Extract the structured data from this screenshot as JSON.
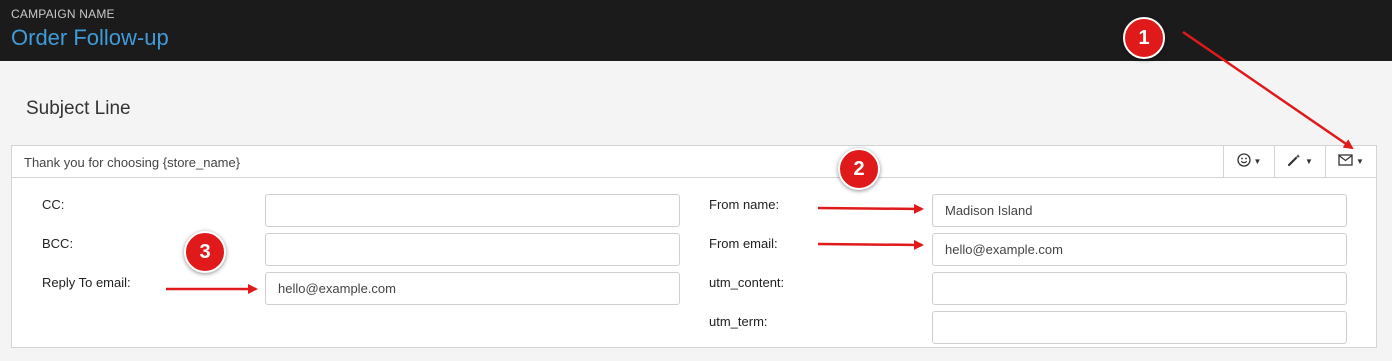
{
  "header": {
    "campaign_label": "CAMPAIGN NAME",
    "campaign_name": "Order Follow-up"
  },
  "subject": {
    "title": "Subject Line",
    "value": "Thank you for choosing {store_name}",
    "tools": [
      {
        "name": "emoji-dropdown",
        "icon": "smiley-icon"
      },
      {
        "name": "personalize-dropdown",
        "icon": "magic-wand-icon"
      },
      {
        "name": "email-settings-dropdown",
        "icon": "envelope-icon"
      }
    ]
  },
  "fields": {
    "cc": {
      "label": "CC:",
      "value": ""
    },
    "bcc": {
      "label": "BCC:",
      "value": ""
    },
    "reply_to": {
      "label": "Reply To email:",
      "value": "hello@example.com"
    },
    "from_name": {
      "label": "From name:",
      "value": "Madison Island"
    },
    "from_email": {
      "label": "From email:",
      "value": "hello@example.com"
    },
    "utm_content": {
      "label": "utm_content:",
      "value": ""
    },
    "utm_term": {
      "label": "utm_term:",
      "value": ""
    }
  },
  "annotations": {
    "badges": [
      "1",
      "2",
      "3"
    ],
    "color": "#e01a1a"
  }
}
